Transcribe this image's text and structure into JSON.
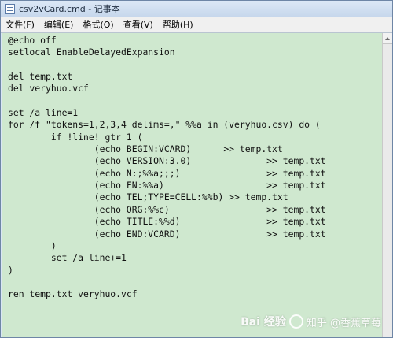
{
  "window": {
    "title": "csv2vCard.cmd - 记事本"
  },
  "menubar": {
    "items": [
      "文件(F)",
      "编辑(E)",
      "格式(O)",
      "查看(V)",
      "帮助(H)"
    ]
  },
  "editor": {
    "content": "@echo off\nsetlocal EnableDelayedExpansion\n\ndel temp.txt\ndel veryhuo.vcf\n\nset /a line=1\nfor /f \"tokens=1,2,3,4 delims=,\" %%a in (veryhuo.csv) do (\n\tif !line! gtr 1 (\n\t\t(echo BEGIN:VCARD)\t>> temp.txt\n\t\t(echo VERSION:3.0)\t\t>> temp.txt\n\t\t(echo N:;%%a;;;)\t\t>> temp.txt\n\t\t(echo FN:%%a)\t\t\t>> temp.txt\n\t\t(echo TEL;TYPE=CELL:%%b) >> temp.txt\n\t\t(echo ORG:%%c)\t\t\t>> temp.txt\n\t\t(echo TITLE:%%d)\t\t>> temp.txt\n\t\t(echo END:VCARD)\t\t>> temp.txt\n\t)\n\tset /a line+=1\n)\n\nren temp.txt veryhuo.vcf"
  },
  "watermark": {
    "text": "知乎 @香蕉草莓",
    "logo": "Bai 经验"
  }
}
